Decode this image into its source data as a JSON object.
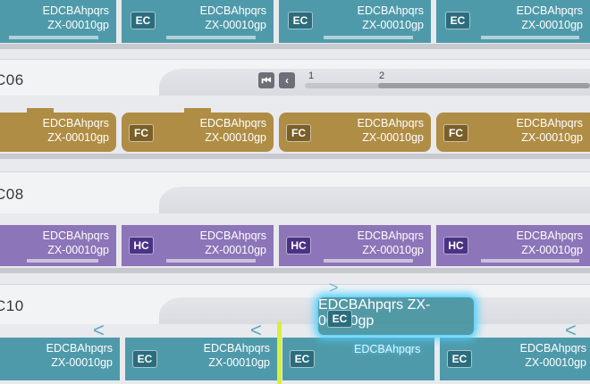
{
  "train_lines": [
    {
      "label": "",
      "type_code": "EC",
      "color": "#4f9aaa",
      "dark": "#2b6d7d"
    },
    {
      "label": "C06",
      "type_code": "FC",
      "color": "#b08d45",
      "dark": "#7a5f28"
    },
    {
      "label": "C08",
      "type_code": "HC",
      "color": "#8c75b8",
      "dark": "#4a3385"
    },
    {
      "label": "C10",
      "type_code": "EC",
      "color": "#4f9aaa",
      "dark": "#2b6d7d"
    }
  ],
  "car_name": "EDCBAhpqrs",
  "car_id": "ZX-00010gp",
  "pager": {
    "first_icon": "skip-first-icon",
    "prev_icon": "chevron-left-icon",
    "page1": "1",
    "page2": "2",
    "progress": 0.1
  },
  "selected_car": {
    "type_code": "EC",
    "name": "EDCBAhpqrs",
    "id": "ZX-00010gp",
    "ghost_label": "EDCBAhpqrs",
    "drag_arrow": ">"
  },
  "direction_arrow": "<",
  "coupler_glyph": "↔"
}
